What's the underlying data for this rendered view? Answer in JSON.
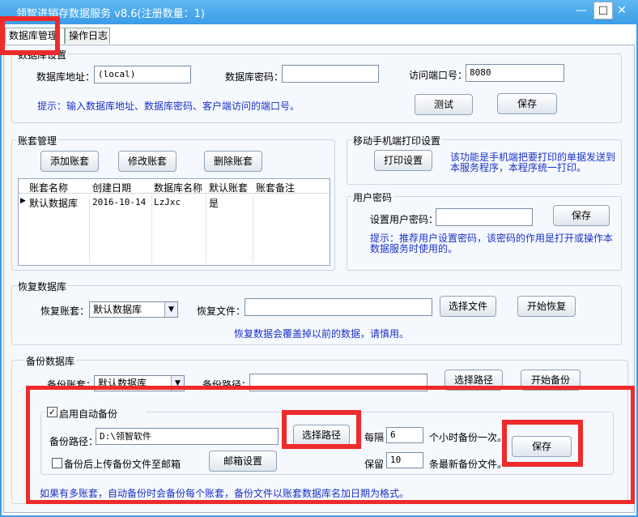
{
  "window": {
    "title": "领智进销存数据服务 v8.6(注册数量：1)",
    "minimize_glyph": "—",
    "maximize_glyph": "☐",
    "close_glyph": "✕"
  },
  "tabs": [
    {
      "label": "数据库管理"
    },
    {
      "label": "操作日志"
    }
  ],
  "db_settings": {
    "group_title": "数据库设置",
    "address_label": "数据库地址：",
    "address_value": "(local)",
    "password_label": "数据库密码：",
    "password_value": "",
    "port_label": "访问端口号：",
    "port_value": "8080",
    "hint": "提示：输入数据库地址、数据库密码、客户端访问的端口号。",
    "test_button": "测试",
    "save_button": "保存"
  },
  "accounts": {
    "group_title": "账套管理",
    "add_button": "添加账套",
    "edit_button": "修改账套",
    "delete_button": "删除账套",
    "columns": [
      "账套名称",
      "创建日期",
      "数据库名称",
      "默认账套",
      "账套备注"
    ],
    "rows": [
      {
        "marker": "▶",
        "name": "默认数据库",
        "date": "2016-10-14",
        "db": "LzJxc",
        "default": "是",
        "note": ""
      }
    ]
  },
  "mobile_print": {
    "group_title": "移动手机端打印设置",
    "button": "打印设置",
    "hint_line1": "该功能是手机端把要打印的单据发送到",
    "hint_line2": "本服务程序，本程序统一打印。"
  },
  "user_password": {
    "group_title": "用户密码",
    "label": "设置用户密码：",
    "value": "",
    "save_button": "保存",
    "hint_line1": "提示：推荐用户设置密码，该密码的作用是打开或操作本",
    "hint_line2": "数据服务时使用的。"
  },
  "restore": {
    "group_title": "恢复数据库",
    "account_label": "恢复账套：",
    "account_value": "默认数据库",
    "file_label": "恢复文件：",
    "file_value": "",
    "choose_button": "选择文件",
    "start_button": "开始恢复",
    "warning": "恢复数据会覆盖掉以前的数据，请慎用。"
  },
  "backup": {
    "group_title": "备份数据库",
    "account_label": "备份账套：",
    "account_value": "默认数据库",
    "path_label": "备份路径：",
    "path_value": "",
    "choose_button": "选择路径",
    "start_button": "开始备份",
    "auto": {
      "checkbox_label": "启用自动备份",
      "checked": true,
      "check_glyph": "✓",
      "path_label": "备份路径：",
      "path_value": "D:\\领智软件",
      "choose_button": "选择路径",
      "interval_label": "每隔",
      "interval_value": "6",
      "interval_suffix": "个小时备份一次。",
      "upload_label": "备份后上传备份文件至邮箱",
      "upload_checked": false,
      "mail_button": "邮箱设置",
      "keep_label": "保留",
      "keep_value": "10",
      "keep_suffix": "条最新备份文件。",
      "save_button": "保存"
    },
    "footer_hint": "如果有多账套，自动备份时会备份每个账套，备份文件以账套数据库名加日期为格式。"
  }
}
